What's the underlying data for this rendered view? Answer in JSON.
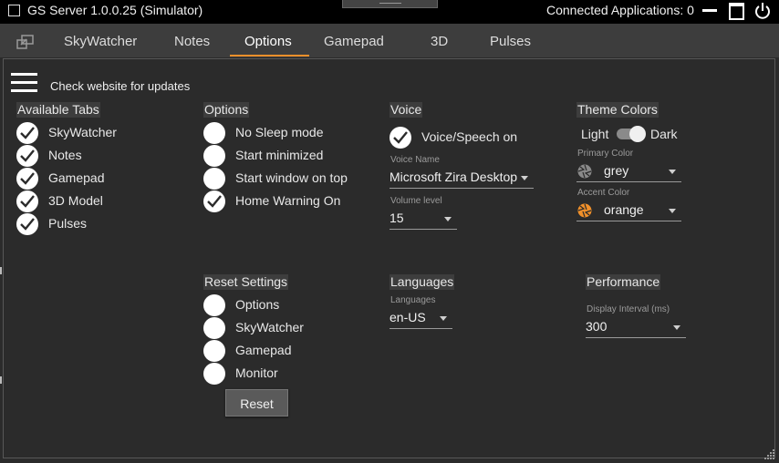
{
  "window": {
    "title": "GS Server 1.0.0.25 (Simulator)",
    "connected_label": "Connected Applications: 0"
  },
  "tabs": [
    {
      "label": "SkyWatcher"
    },
    {
      "label": "Notes"
    },
    {
      "label": "Options",
      "selected": true
    },
    {
      "label": "Gamepad"
    },
    {
      "label": "3D"
    },
    {
      "label": "Pulses"
    }
  ],
  "check_updates": "Check website for updates",
  "available_tabs": {
    "header": "Available Tabs",
    "items": [
      {
        "label": "SkyWatcher",
        "checked": true
      },
      {
        "label": "Notes",
        "checked": true
      },
      {
        "label": "Gamepad",
        "checked": true
      },
      {
        "label": "3D Model",
        "checked": true
      },
      {
        "label": "Pulses",
        "checked": true
      }
    ]
  },
  "options": {
    "header": "Options",
    "items": [
      {
        "label": "No Sleep mode",
        "checked": false
      },
      {
        "label": "Start minimized",
        "checked": false
      },
      {
        "label": "Start window on top",
        "checked": false
      },
      {
        "label": "Home Warning On",
        "checked": true
      }
    ]
  },
  "voice": {
    "header": "Voice",
    "speech_label": "Voice/Speech on",
    "speech_checked": true,
    "voice_name_label": "Voice Name",
    "voice_name_value": "Microsoft Zira Desktop",
    "volume_label": "Volume level",
    "volume_value": "15"
  },
  "theme": {
    "header": "Theme Colors",
    "light_label": "Light",
    "dark_label": "Dark",
    "dark_on": true,
    "primary_label": "Primary Color",
    "primary_value": "grey",
    "primary_color": "#8a8a8a",
    "accent_label": "Accent Color",
    "accent_value": "orange",
    "accent_color": "#f0902a"
  },
  "reset_settings": {
    "header": "Reset Settings",
    "items": [
      {
        "label": "Options",
        "checked": false
      },
      {
        "label": "SkyWatcher",
        "checked": false
      },
      {
        "label": "Gamepad",
        "checked": false
      },
      {
        "label": "Monitor",
        "checked": false
      }
    ],
    "button_label": "Reset"
  },
  "languages": {
    "header": "Languages",
    "field_label": "Languages",
    "value": "en-US"
  },
  "performance": {
    "header": "Performance",
    "field_label": "Display Interval (ms)",
    "value": "300"
  }
}
